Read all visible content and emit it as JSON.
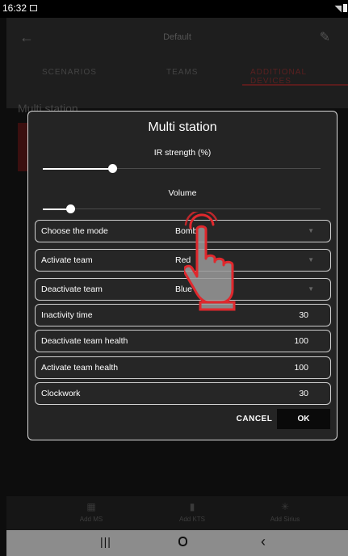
{
  "status_bar": {
    "time": "16:32"
  },
  "app_bar": {
    "title": "Default"
  },
  "tabs": [
    {
      "label": "SCENARIOS"
    },
    {
      "label": "TEAMS"
    },
    {
      "label": "ADDITIONAL DEVICES"
    }
  ],
  "background": {
    "section_title": "Multi station"
  },
  "dialog": {
    "title": "Multi station",
    "ir_strength": {
      "label": "IR strength (%)",
      "level": 0.25
    },
    "volume": {
      "label": "Volume",
      "level": 0.1
    },
    "rows": [
      {
        "label": "Choose the mode",
        "value": "Bomb"
      },
      {
        "label": "Activate team",
        "value": "Red"
      },
      {
        "label": "Deactivate team",
        "value": "Blue"
      },
      {
        "label": "Inactivity time",
        "value": "30"
      },
      {
        "label": "Deactivate team health",
        "value": "100"
      },
      {
        "label": "Activate team health",
        "value": "100"
      },
      {
        "label": "Clockwork",
        "value": "30"
      }
    ],
    "cancel_label": "CANCEL",
    "ok_label": "OK"
  },
  "bottom_bar": {
    "items": [
      {
        "label": "Add MS",
        "icon": "grid-icon"
      },
      {
        "label": "Add KTS",
        "icon": "device-icon"
      },
      {
        "label": "Add Sirius",
        "icon": "sirius-icon"
      }
    ]
  },
  "colors": {
    "accent": "#e0282d",
    "dialog_bg": "#242424",
    "background": "#0d0d0d"
  }
}
